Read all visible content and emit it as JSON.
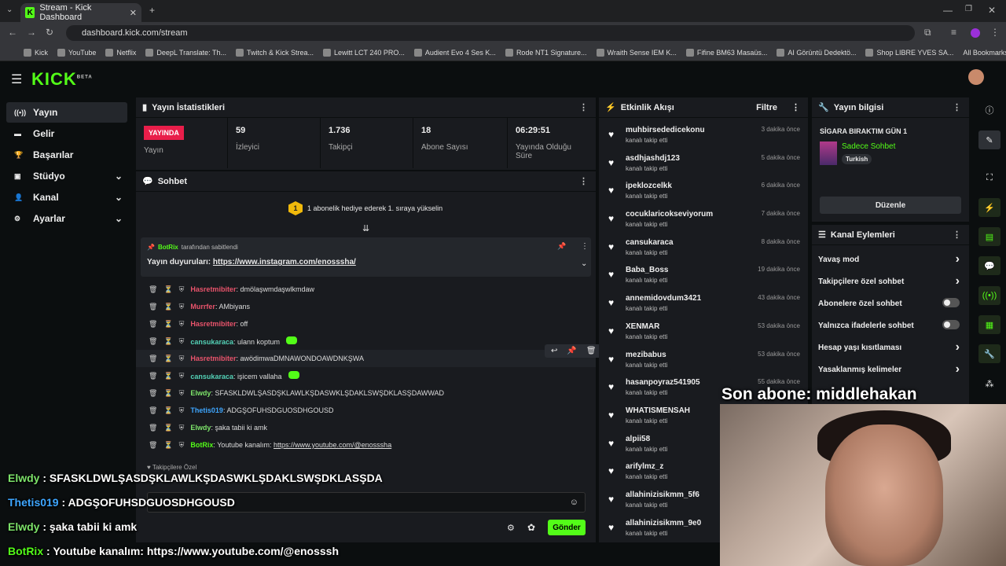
{
  "browser": {
    "tab_title": "Stream - Kick Dashboard",
    "url": "dashboard.kick.com/stream",
    "bookmarks": [
      "Kick",
      "YouTube",
      "Netflix",
      "DeepL Translate: Th...",
      "Twitch & Kick Strea...",
      "Lewitt LCT 240 PRO...",
      "Audient Evo 4 Ses K...",
      "Rode NT1 Signature...",
      "Wraith Sense IEM K...",
      "Fifine BM63 Masaüs...",
      "AI Görüntü Dedektö...",
      "Shop LIBRE YVES SA..."
    ],
    "all_bookmarks": "All Bookmarks"
  },
  "app": {
    "logo": "KICK",
    "logo_beta": "BETA"
  },
  "sidebar": {
    "items": [
      {
        "label": "Yayın",
        "icon": "broadcast-icon"
      },
      {
        "label": "Gelir",
        "icon": "wallet-icon"
      },
      {
        "label": "Başarılar",
        "icon": "trophy-icon"
      },
      {
        "label": "Stüdyo",
        "icon": "studio-icon"
      },
      {
        "label": "Kanal",
        "icon": "user-icon"
      },
      {
        "label": "Ayarlar",
        "icon": "gear-icon"
      }
    ]
  },
  "stats": {
    "title": "Yayın İstatistikleri",
    "live_badge": "YAYINDA",
    "live_label": "Yayın",
    "viewers": "59",
    "viewers_label": "İzleyici",
    "followers": "1.736",
    "followers_label": "Takipçi",
    "subs": "18",
    "subs_label": "Abone Sayısı",
    "uptime": "06:29:51",
    "uptime_label": "Yayında Olduğu Süre"
  },
  "chat": {
    "title": "Sohbet",
    "goal_number": "1",
    "goal_text": "1 abonelik hediye ederek 1. sıraya yükselin",
    "pinned_by_user": "BotRix",
    "pinned_by_suffix": "tarafından sabitlendi",
    "pinned_prefix": "Yayın duyuruları:",
    "pinned_link": "https://www.instagram.com/enosssha/",
    "messages": [
      {
        "user": "Hasretmibiter",
        "color": "#e8536b",
        "text": ": dmölaşwmdaşwlkmdaw"
      },
      {
        "user": "Murrfer",
        "color": "#e8536b",
        "text": ": AMbiyans"
      },
      {
        "user": "Hasretmibiter",
        "color": "#e8536b",
        "text": ": off"
      },
      {
        "user": "cansukaraca",
        "color": "#53d1b6",
        "text": ": ulann koptum"
      },
      {
        "user": "Hasretmibiter",
        "color": "#e8536b",
        "text": ": awödimwaDMNAWONDOAWDNKŞWA"
      },
      {
        "user": "cansukaraca",
        "color": "#53d1b6",
        "text": ": işicem vallaha"
      },
      {
        "user": "Elwdy",
        "color": "#7de36a",
        "text": ": SFASKLDWLŞASDŞKLAWLKŞDASWKLŞDAKLSWŞDKLASŞDAWWAD"
      },
      {
        "user": "Thetis019",
        "color": "#3ea6ff",
        "text": ": ADGŞOFUHSDGUOSDHGOUSD"
      },
      {
        "user": "Elwdy",
        "color": "#7de36a",
        "text": ": şaka tabii ki amk"
      },
      {
        "user": "BotRix",
        "color": "#53fc18",
        "text": ": Youtube kanalım: ",
        "link": "https://www.youtube.com/@enosssha"
      }
    ],
    "followers_only": "Takipçilere Özel",
    "send_label": "Gönder"
  },
  "events": {
    "title": "Etkinlik Akışı",
    "filter_label": "Filtre",
    "sub_text": "kanalı takip etti",
    "items": [
      {
        "user": "muhbirsededicekonu",
        "time": "3 dakika önce"
      },
      {
        "user": "asdhjashdj123",
        "time": "5 dakika önce"
      },
      {
        "user": "ipeklozcelkk",
        "time": "6 dakika önce"
      },
      {
        "user": "cocuklaricokseviyorum",
        "time": "7 dakika önce"
      },
      {
        "user": "cansukaraca",
        "time": "8 dakika önce"
      },
      {
        "user": "Baba_Boss",
        "time": "19 dakika önce"
      },
      {
        "user": "annemidovdum3421",
        "time": "43 dakika önce"
      },
      {
        "user": "XENMAR",
        "time": "53 dakika önce"
      },
      {
        "user": "mezibabus",
        "time": "53 dakika önce"
      },
      {
        "user": "hasanpoyraz541905",
        "time": "55 dakika önce"
      },
      {
        "user": "WHATISMENSAH",
        "time": ""
      },
      {
        "user": "alpii58",
        "time": ""
      },
      {
        "user": "arifylmz_z",
        "time": ""
      },
      {
        "user": "allahinizisikmm_5f6",
        "time": ""
      },
      {
        "user": "allahinizisikmm_9e0",
        "time": ""
      }
    ]
  },
  "stream_info": {
    "title": "Yayın bilgisi",
    "stream_title": "SİGARA BIRAKTIM GÜN 1",
    "category": "Sadece Sohbet",
    "language": "Turkish",
    "edit_label": "Düzenle"
  },
  "channel_actions": {
    "title": "Kanal Eylemleri",
    "items": [
      {
        "label": "Yavaş mod",
        "type": "arrow"
      },
      {
        "label": "Takipçilere özel sohbet",
        "type": "arrow"
      },
      {
        "label": "Abonelere özel sohbet",
        "type": "toggle"
      },
      {
        "label": "Yalnızca ifadelerle sohbet",
        "type": "toggle"
      },
      {
        "label": "Hesap yaşı kısıtlaması",
        "type": "arrow"
      },
      {
        "label": "Yasaklanmış kelimeler",
        "type": "arrow"
      }
    ]
  },
  "overlay": {
    "last_sub": "Son abone: middlehakan",
    "lines": [
      {
        "user": "Elwdy",
        "color": "#7de36a",
        "text": " : SFASKLDWLŞASDŞKLAWLKŞDASWKLŞDAKLSWŞDKLASŞDA"
      },
      {
        "user": "Thetis019",
        "color": "#3ea6ff",
        "text": " : ADGŞOFUHSDGUOSDHGOUSD"
      },
      {
        "user": "Elwdy",
        "color": "#7de36a",
        "text": " : şaka tabii ki amk"
      },
      {
        "user": "BotRix",
        "color": "#53fc18",
        "text": " : Youtube kanalım: https://www.youtube.com/@enosssh"
      }
    ]
  }
}
